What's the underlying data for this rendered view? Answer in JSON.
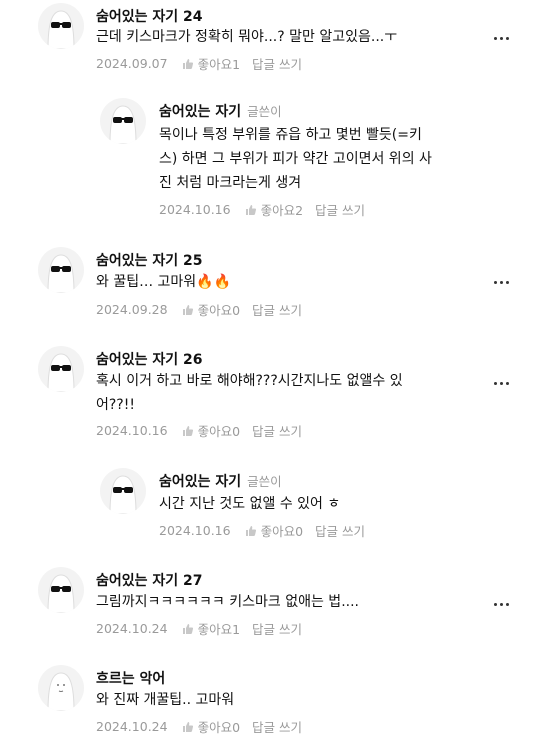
{
  "comments": [
    {
      "author": "숨어있는 자기 24",
      "lines": [
        "근데 키스마크가 정확히 뭐야...? 말만 알고있음...ㅜ"
      ],
      "date": "2024.09.07",
      "like_label": "좋아요1",
      "reply_label": "답글 쓰기",
      "avatar_icon": "sunglasses-ghost-avatar"
    },
    {
      "author": "숨어있는 자기",
      "badge": "글쓴이",
      "lines": [
        "목이나 특정 부위를 쥬읍 하고 몇번 빨듯(=키",
        "스) 하면 그 부위가 피가 약간 고이면서 위의 사",
        "진 처럼 마크라는게 생겨"
      ],
      "date": "2024.10.16",
      "like_label": "좋아요2",
      "reply_label": "답글 쓰기",
      "avatar_icon": "sunglasses-ghost-avatar"
    },
    {
      "author": "숨어있는 자기 25",
      "lines": [
        "와 꿀팁… 고마워🔥🔥"
      ],
      "date": "2024.09.28",
      "like_label": "좋아요0",
      "reply_label": "답글 쓰기",
      "avatar_icon": "sunglasses-ghost-avatar"
    },
    {
      "author": "숨어있는 자기 26",
      "lines": [
        "혹시 이거 하고 바로 해야해???시간지나도 없앨수 있",
        "어??!!"
      ],
      "date": "2024.10.16",
      "like_label": "좋아요0",
      "reply_label": "답글 쓰기",
      "avatar_icon": "sunglasses-ghost-avatar"
    },
    {
      "author": "숨어있는 자기",
      "badge": "글쓴이",
      "lines": [
        "시간 지난 것도 없앨 수 있어 ㅎ"
      ],
      "date": "2024.10.16",
      "like_label": "좋아요0",
      "reply_label": "답글 쓰기",
      "avatar_icon": "sunglasses-ghost-avatar"
    },
    {
      "author": "숨어있는 자기 27",
      "lines": [
        "그림까지ㅋㅋㅋㅋㅋㅋ 키스마크 없애는 법...."
      ],
      "date": "2024.10.24",
      "like_label": "좋아요1",
      "reply_label": "답글 쓰기",
      "avatar_icon": "sunglasses-ghost-avatar"
    },
    {
      "author": "흐르는 악어",
      "lines": [
        "와 진짜 개꿀팁.. 고마워"
      ],
      "date": "2024.10.24",
      "like_label": "좋아요0",
      "reply_label": "답글 쓰기",
      "avatar_icon": "plain-ghost-avatar"
    }
  ],
  "icons": {
    "like": "thumbs-up-icon",
    "more": "more-options-icon"
  }
}
